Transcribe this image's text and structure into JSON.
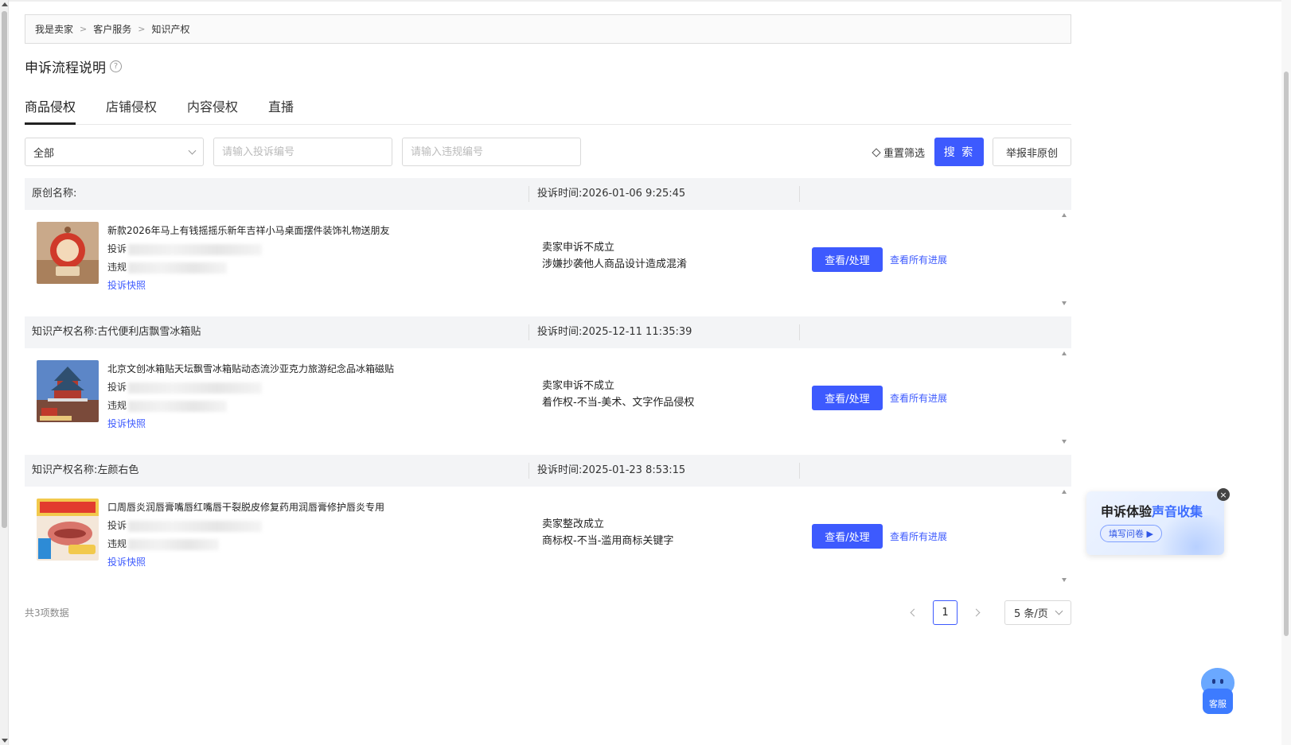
{
  "breadcrumb": [
    "我是卖家",
    "客户服务",
    "知识产权"
  ],
  "page_title": "申诉流程说明",
  "tabs": [
    "商品侵权",
    "店铺侵权",
    "内容侵权",
    "直播"
  ],
  "filters": {
    "select_value": "全部",
    "complaint_no_placeholder": "请输入投诉编号",
    "violation_no_placeholder": "请输入违规编号",
    "reset_label": "重置筛选",
    "search_label": "搜 索",
    "report_label": "举报非原创"
  },
  "records": [
    {
      "head_left": "原创名称:",
      "head_time": "投诉时间:2026-01-06 9:25:45",
      "title": "新款2026年马上有钱摇摇乐新年吉祥小马桌面摆件装饰礼物送朋友",
      "complaint_prefix": "投诉",
      "violation_prefix": "违规",
      "snapshot": "投诉快照",
      "status": "卖家申诉不成立",
      "reason": "涉嫌抄袭他人商品设计造成混淆",
      "view_btn": "查看/处理",
      "progress_link": "查看所有进展"
    },
    {
      "head_left": "知识产权名称:古代便利店飘雪冰箱贴",
      "head_time": "投诉时间:2025-12-11 11:35:39",
      "title": "北京文创冰箱贴天坛飘雪冰箱贴动态流沙亚克力旅游纪念品冰箱磁贴",
      "complaint_prefix": "投诉",
      "violation_prefix": "违规",
      "snapshot": "投诉快照",
      "status": "卖家申诉不成立",
      "reason": "着作权-不当-美术、文字作品侵权",
      "view_btn": "查看/处理",
      "progress_link": "查看所有进展"
    },
    {
      "head_left": "知识产权名称:左颜右色",
      "head_time": "投诉时间:2025-01-23 8:53:15",
      "title": "口周唇炎润唇膏嘴唇红嘴唇干裂脱皮修复药用润唇膏修护唇炎专用",
      "complaint_prefix": "投诉",
      "violation_prefix": "违规",
      "snapshot": "投诉快照",
      "status": "卖家整改成立",
      "reason": "商标权-不当-滥用商标关键字",
      "view_btn": "查看/处理",
      "progress_link": "查看所有进展"
    }
  ],
  "footer": {
    "total": "共3项数据",
    "current_page": "1",
    "page_size": "5 条/页"
  },
  "survey": {
    "title_a": "申诉体验",
    "title_b": "声音收集",
    "button": "填写问卷 ▶",
    "close": "×"
  },
  "customer_service": "客服",
  "colors": {
    "primary": "#3d5afe"
  }
}
